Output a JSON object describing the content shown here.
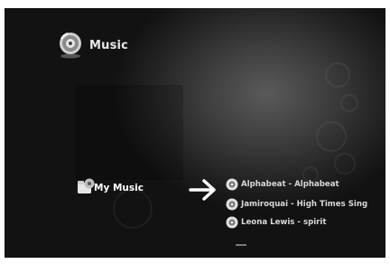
{
  "header": {
    "title": "Music",
    "icon": "music-disc-icon"
  },
  "selection": {
    "label": "My Music",
    "icon": "music-folder-icon"
  },
  "indicator": {
    "icon": "right-arrow-icon"
  },
  "songs": [
    {
      "label": "Alphabeat - Alphabeat",
      "icon": "cd-icon"
    },
    {
      "label": "Jamiroquai - High Times Sing",
      "icon": "cd-icon"
    },
    {
      "label": "Leona Lewis - spirit",
      "icon": "cd-icon"
    }
  ],
  "colors": {
    "background": "#2b2b2b",
    "text": "#ffffff",
    "arrow": "#ffffff"
  }
}
